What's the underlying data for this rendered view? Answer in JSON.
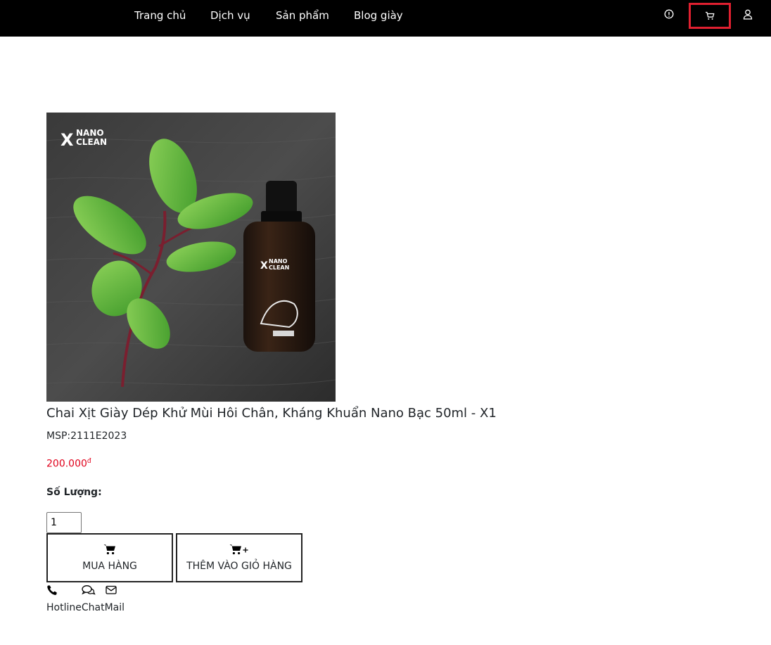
{
  "nav": {
    "items": [
      {
        "label": "Trang chủ"
      },
      {
        "label": "Dịch vụ"
      },
      {
        "label": "Sản phẩm"
      },
      {
        "label": "Blog giày"
      }
    ],
    "icons": [
      "info-icon",
      "cart-icon",
      "user-icon"
    ]
  },
  "product": {
    "image_brand": "NANO CLEAN",
    "title": "Chai Xịt Giày Dép Khử Mùi Hôi Chân, Kháng Khuẩn Nano Bạc 50ml - X1",
    "sku": "MSP:2111E2023",
    "price": "200.000",
    "currency": "đ",
    "quantity_label": "Số Lượng:",
    "quantity_value": "1"
  },
  "actions": {
    "buy_label": "MUA HÀNG",
    "add_to_cart_label": "THÊM VÀO GIỎ HÀNG"
  },
  "contact": {
    "hotline": "Hotline",
    "chat": "Chat",
    "mail": "Mail"
  },
  "colors": {
    "topbar": "#000000",
    "price": "#e0001b",
    "cart_highlight": "#e02030"
  }
}
